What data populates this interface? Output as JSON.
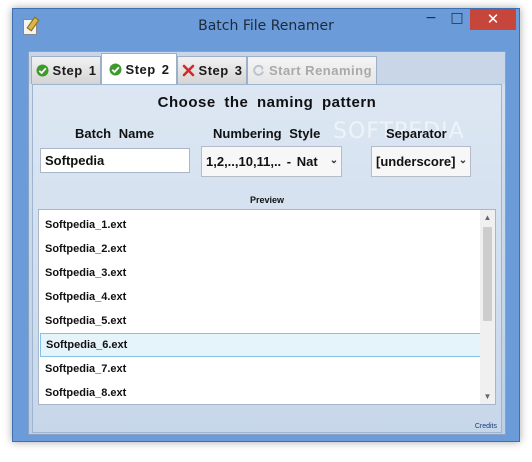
{
  "window": {
    "title": "Batch File Renamer",
    "minimize": "−",
    "maximize": "□",
    "close": "✕"
  },
  "tabs": [
    {
      "label": "Step",
      "num": "1",
      "icon": "check-icon",
      "state": "done"
    },
    {
      "label": "Step",
      "num": "2",
      "icon": "check-icon",
      "state": "active"
    },
    {
      "label": "Step",
      "num": "3",
      "icon": "cross-icon",
      "state": "pending"
    },
    {
      "label": "Start Renaming",
      "icon": "refresh-icon",
      "state": "disabled"
    }
  ],
  "panel": {
    "heading": "Choose the naming pattern",
    "batch_name_label": "Batch Name",
    "numbering_label": "Numbering Style",
    "separator_label": "Separator",
    "watermark": "SOFTPEDIA",
    "batch_name_value": "Softpedia",
    "numbering_value": "1,2,..,10,11,.. - Nat",
    "separator_value": "[underscore]",
    "preview_label": "Preview"
  },
  "preview": {
    "items": [
      "Softpedia_1.ext",
      "Softpedia_2.ext",
      "Softpedia_3.ext",
      "Softpedia_4.ext",
      "Softpedia_5.ext",
      "Softpedia_6.ext",
      "Softpedia_7.ext",
      "Softpedia_8.ext"
    ],
    "selected_index": 5
  },
  "footer": {
    "credits": "Credits"
  },
  "colors": {
    "titlebar": "#6b9bd8",
    "close": "#c7463b",
    "check_green": "#3f9a2e",
    "cross_red": "#d8262c",
    "selection": "#e5f3fb"
  }
}
